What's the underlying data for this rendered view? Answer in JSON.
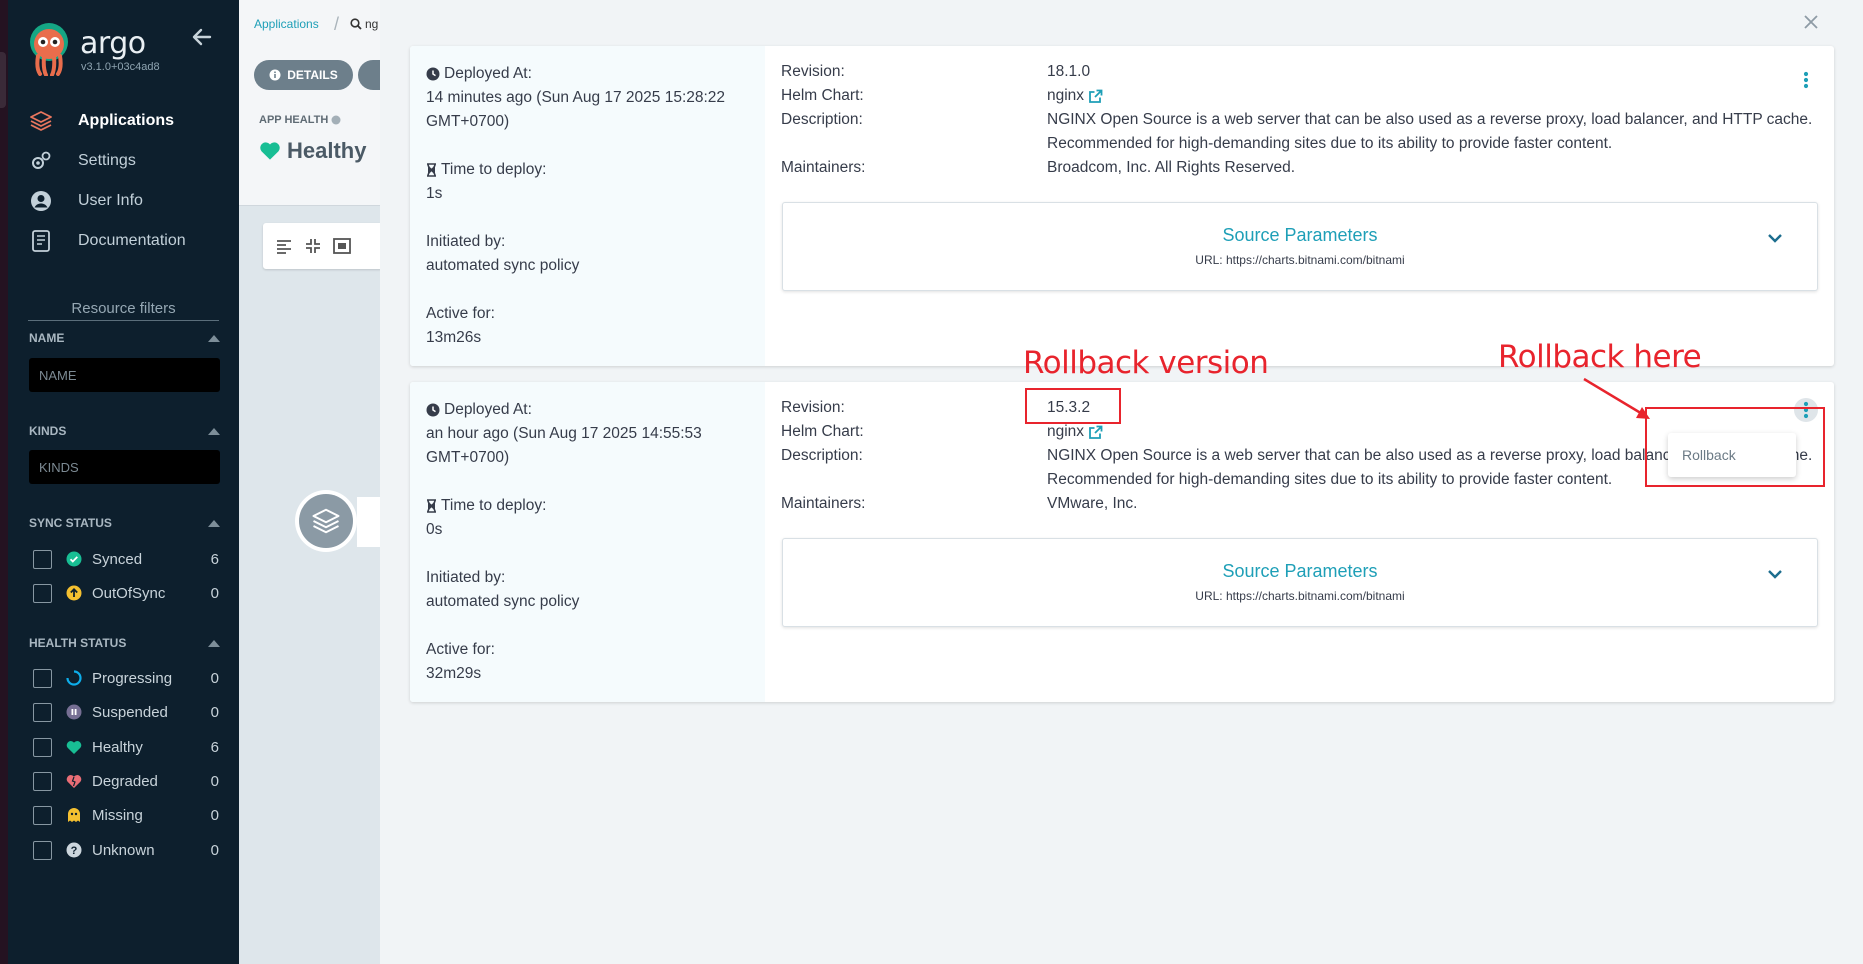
{
  "sidebar": {
    "brand": "argo",
    "version": "v3.1.0+03c4ad8",
    "nav": [
      {
        "label": "Applications",
        "icon": "layers-icon"
      },
      {
        "label": "Settings",
        "icon": "gears-icon"
      },
      {
        "label": "User Info",
        "icon": "user-icon"
      },
      {
        "label": "Documentation",
        "icon": "book-icon"
      }
    ],
    "filters_title": "Resource filters",
    "name_filter": {
      "label": "NAME",
      "placeholder": "NAME"
    },
    "kinds_filter": {
      "label": "KINDS",
      "placeholder": "KINDS"
    },
    "sync_status": {
      "label": "SYNC STATUS",
      "items": [
        {
          "label": "Synced",
          "count": "6",
          "color": "#18be94"
        },
        {
          "label": "OutOfSync",
          "count": "0",
          "color": "#f4c030"
        }
      ]
    },
    "health_status": {
      "label": "HEALTH STATUS",
      "items": [
        {
          "label": "Progressing",
          "count": "0",
          "color": "#0dadea"
        },
        {
          "label": "Suspended",
          "count": "0",
          "color": "#766f94"
        },
        {
          "label": "Healthy",
          "count": "6",
          "color": "#18be94"
        },
        {
          "label": "Degraded",
          "count": "0",
          "color": "#e96d76"
        },
        {
          "label": "Missing",
          "count": "0",
          "color": "#f4c030"
        },
        {
          "label": "Unknown",
          "count": "0",
          "color": "#ccd6dd"
        }
      ]
    }
  },
  "app": {
    "breadcrumb_root": "Applications",
    "breadcrumb_current": "ng",
    "details_button": "DETAILS",
    "app_health_label": "APP HEALTH",
    "health_value": "Healthy"
  },
  "history": [
    {
      "deployed_at_label": "Deployed At:",
      "deployed_at": "14 minutes ago (Sun Aug 17 2025 15:28:22 GMT+0700)",
      "time_to_deploy_label": "Time to deploy:",
      "time_to_deploy": "1s",
      "initiated_by_label": "Initiated by:",
      "initiated_by": "automated sync policy",
      "active_for_label": "Active for:",
      "active_for": "13m26s",
      "revision_label": "Revision:",
      "revision": "18.1.0",
      "helm_chart_label": "Helm Chart:",
      "helm_chart": "nginx",
      "description_label": "Description:",
      "description": "NGINX Open Source is a web server that can be also used as a reverse proxy, load balancer, and HTTP cache. Recommended for high-demanding sites due to its ability to provide faster content.",
      "maintainers_label": "Maintainers:",
      "maintainers": "Broadcom, Inc. All Rights Reserved.",
      "source_title": "Source Parameters",
      "source_url": "URL: https://charts.bitnami.com/bitnami"
    },
    {
      "deployed_at_label": "Deployed At:",
      "deployed_at": "an hour ago (Sun Aug 17 2025 14:55:53 GMT+0700)",
      "time_to_deploy_label": "Time to deploy:",
      "time_to_deploy": "0s",
      "initiated_by_label": "Initiated by:",
      "initiated_by": "automated sync policy",
      "active_for_label": "Active for:",
      "active_for": "32m29s",
      "revision_label": "Revision:",
      "revision": "15.3.2",
      "helm_chart_label": "Helm Chart:",
      "helm_chart": "nginx",
      "description_label": "Description:",
      "description": "NGINX Open Source is a web server that can be also used as a reverse proxy, load balancer, and HTTP cache. Recommended for high-demanding sites due to its ability to provide faster content.",
      "maintainers_label": "Maintainers:",
      "maintainers": "VMware, Inc.",
      "source_title": "Source Parameters",
      "source_url": "URL: https://charts.bitnami.com/bitnami"
    }
  ],
  "context_menu": {
    "item": "Rollback"
  },
  "annotations": {
    "rollback_version": "Rollback version",
    "rollback_here": "Rollback here",
    "color": "#e8242d"
  }
}
